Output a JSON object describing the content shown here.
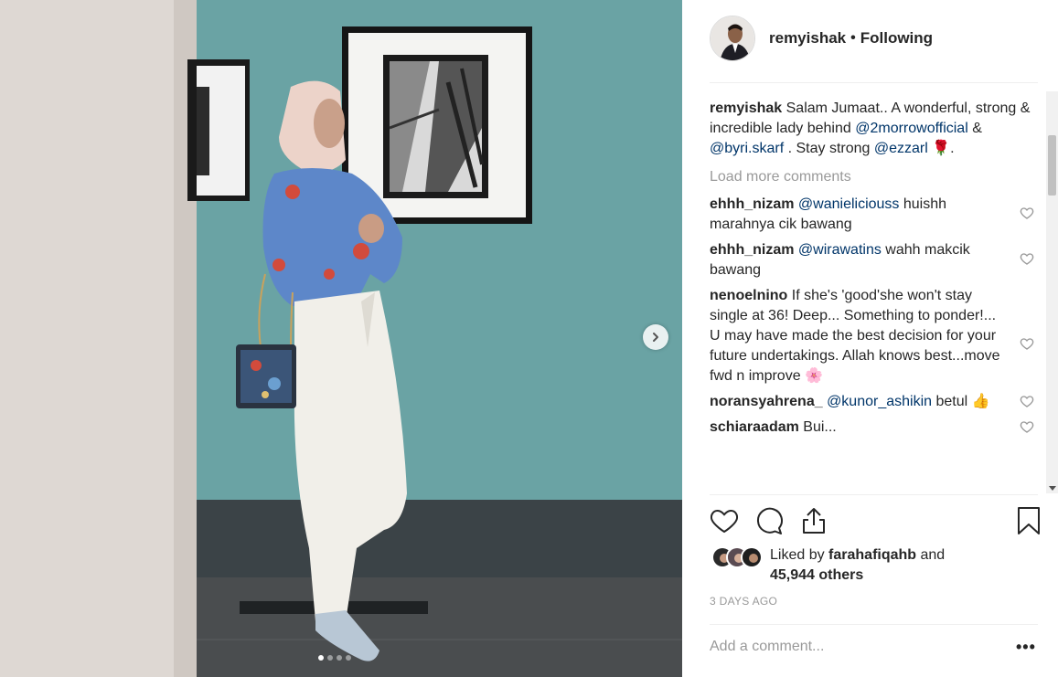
{
  "post": {
    "username": "remyishak",
    "separator": "•",
    "follow_status": "Following",
    "caption": {
      "text_1": "Salam Jumaat.. A wonderful, strong & incredible lady behind ",
      "mention_1": "@2morrowofficial",
      "text_2": " & ",
      "mention_2": "@byri.skarf",
      "text_3": " . Stay strong ",
      "mention_3": "@ezzarl",
      "emoji": "🌹",
      "text_4": "."
    },
    "load_more": "Load more comments",
    "comments": [
      {
        "user": "ehhh_nizam",
        "mention": "@wanieliciouss",
        "text": " huishh marahnya cik bawang"
      },
      {
        "user": "ehhh_nizam",
        "mention": "@wirawatins",
        "text": " wahh makcik bawang"
      },
      {
        "user": "nenoelnino",
        "mention": "",
        "text": " If she's 'good'she won't stay single at 36! Deep... Something to ponder!... U may have made the best decision for your future undertakings. Allah knows best...move fwd n improve 🌸"
      },
      {
        "user": "noransyahrena_",
        "mention": "@kunor_ashikin",
        "text": " betul 👍"
      },
      {
        "user": "schiaraadam",
        "mention": "",
        "text": " Bui..."
      }
    ],
    "liked_by_prefix": "Liked by ",
    "liked_by_user": "farahafiqahb",
    "liked_by_and": " and",
    "likes_others": "45,944 others",
    "time": "3 DAYS AGO",
    "add_comment_placeholder": "Add a comment...",
    "more_options": "•••"
  },
  "carousel": {
    "total": 4,
    "active": 1
  },
  "icons": {
    "next": "chevron-right-icon",
    "like": "heart-icon",
    "comment": "comment-icon",
    "share": "share-icon",
    "save": "bookmark-icon"
  },
  "colors": {
    "mention": "#003569",
    "muted": "#999999",
    "text": "#262626"
  }
}
